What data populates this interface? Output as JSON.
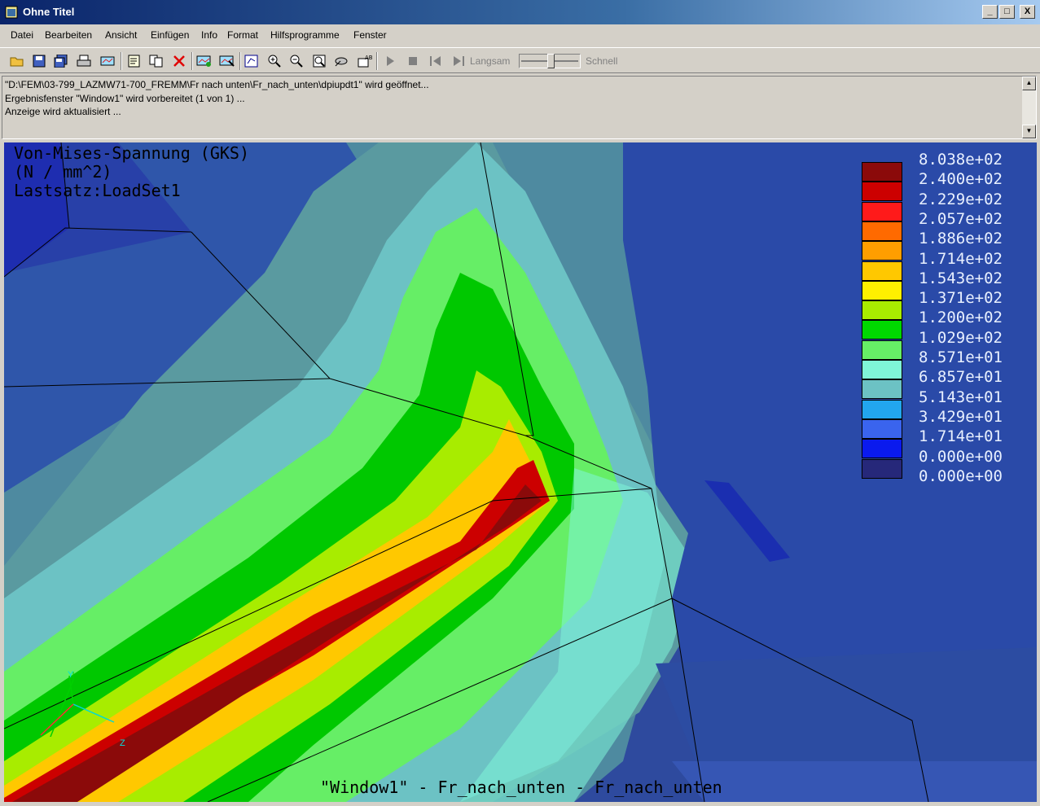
{
  "window": {
    "title": "Ohne Titel",
    "minimize": "_",
    "maximize": "□",
    "close": "X"
  },
  "menu": [
    "Datei",
    "Bearbeiten",
    "Ansicht",
    "Einfügen",
    "Info",
    "Format",
    "Hilfsprogramme",
    "Fenster"
  ],
  "toolbar": {
    "icons": [
      "open-icon",
      "save-icon",
      "save-all-icon",
      "print-icon",
      "window-icon",
      "edit-definition-icon",
      "copy-icon",
      "delete-icon",
      "show-result-icon",
      "show-options-icon",
      "format-icon",
      "zoom-in-icon",
      "zoom-out-icon",
      "zoom-fit-icon",
      "orient-icon",
      "label-icon"
    ],
    "animation_icons": [
      "play-icon",
      "stop-icon",
      "step-back-icon",
      "step-forward-icon"
    ],
    "speed_slow": "Langsam",
    "speed_fast": "Schnell",
    "speed_level": 0.5
  },
  "messages": [
    "\"D:\\FEM\\03-799_LAZMW71-700_FREMM\\Fr nach unten\\Fr_nach_unten\\dpiupdt1\" wird geöffnet...",
    "Ergebnisfenster \"Window1\" wird vorbereitet (1 von 1) ...",
    "Anzeige wird aktualisiert ..."
  ],
  "viewport": {
    "header": [
      "Von-Mises-Spannung (GKS)",
      "(N / mm^2)",
      "Lastsatz:LoadSet1"
    ],
    "footer": "\"Window1\" - Fr_nach_unten - Fr_nach_unten",
    "axes": {
      "y": "Y",
      "z": "Z"
    }
  },
  "legend": {
    "labels": [
      "8.038e+02",
      "2.400e+02",
      "2.229e+02",
      "2.057e+02",
      "1.886e+02",
      "1.714e+02",
      "1.543e+02",
      "1.371e+02",
      "1.200e+02",
      "1.029e+02",
      "8.571e+01",
      "6.857e+01",
      "5.143e+01",
      "3.429e+01",
      "1.714e+01",
      "0.000e+00",
      "0.000e+00"
    ],
    "colors": [
      "#8b0a0a",
      "#cc0000",
      "#ff1a1a",
      "#ff6a00",
      "#ff9e00",
      "#ffc800",
      "#fff000",
      "#a8ec00",
      "#00d800",
      "#66ee66",
      "#7ff5d8",
      "#6cc2c4",
      "#22a6ee",
      "#3a64ee",
      "#0a1aee",
      "#26287a"
    ]
  }
}
